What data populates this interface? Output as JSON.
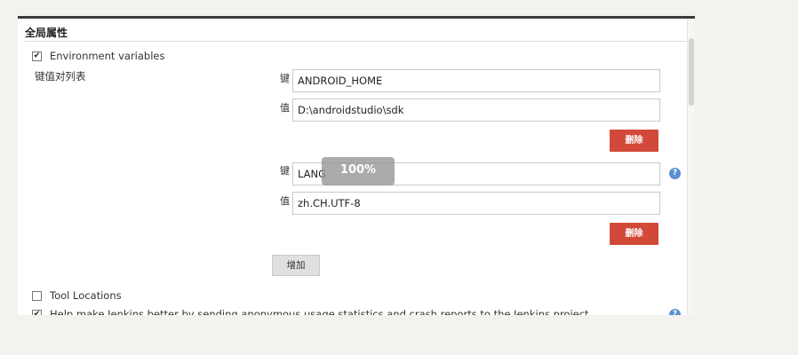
{
  "section": {
    "title": "全局属性"
  },
  "env_vars": {
    "checkbox_label": "Environment variables",
    "checked": true,
    "list_label": "键值对列表",
    "entries": [
      {
        "key_label": "键",
        "key": "ANDROID_HOME",
        "value_label": "值",
        "value": "D:\\androidstudio\\sdk",
        "delete_label": "删除"
      },
      {
        "key_label": "键",
        "key": "LANG",
        "value_label": "值",
        "value": "zh.CH.UTF-8",
        "delete_label": "删除"
      }
    ],
    "add_label": "增加"
  },
  "progress": {
    "text": "100%",
    "value": 100
  },
  "tool_locations": {
    "label": "Tool Locations",
    "checked": false
  },
  "usage_stats": {
    "label": "Help make Jenkins better by sending anonymous usage statistics and crash reports to the Jenkins project.",
    "checked": true
  },
  "help_icon_glyph": "?",
  "colors": {
    "delete_button": "#d24939",
    "help_icon": "#5b8fd0",
    "header_bar": "#3b3b3b"
  },
  "icons": [
    "checkbox-checked-icon",
    "checkbox-unchecked-icon",
    "help-icon"
  ]
}
